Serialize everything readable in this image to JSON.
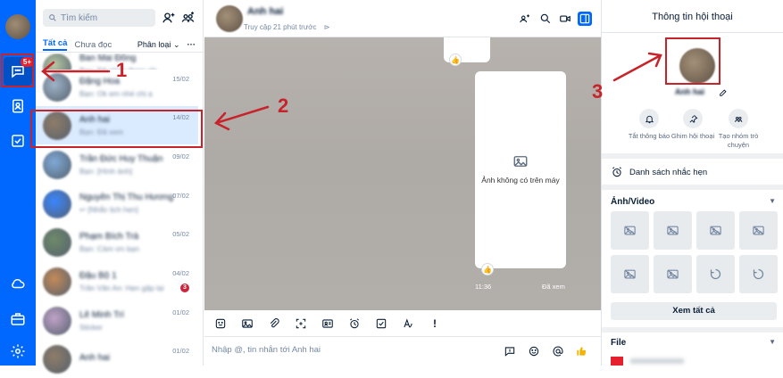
{
  "nav": {
    "badge": "5+"
  },
  "conversation_list": {
    "search_placeholder": "Tìm kiếm",
    "tabs": [
      {
        "label": "Tất cả",
        "active": true
      },
      {
        "label": "Chưa đọc",
        "active": false
      }
    ],
    "filter_label": "Phân loại",
    "more_label": "···",
    "items": [
      {
        "name": "Ban Mai Đông",
        "preview": "Bạn: Đã nhận được rồi",
        "date": "",
        "avatar_color": "#b6c9a4"
      },
      {
        "name": "Đặng Hoa",
        "preview": "Bạn: Ok em nhé chị ạ",
        "date": "15/02",
        "avatar_color": "#9fb4c8"
      },
      {
        "name": "Anh hai",
        "preview": "Bạn: Đã xem",
        "date": "14/02",
        "avatar_color": "#8f7d68",
        "selected": true
      },
      {
        "name": "Trần Đức Huy Thuận",
        "preview": "Bạn: [Hình ảnh]",
        "date": "09/02",
        "avatar_color": "#7fa9d6"
      },
      {
        "name": "Nguyễn Thị Thu Hương",
        "preview": "↩ [Nhắc lịch hẹn]",
        "date": "07/02",
        "avatar_color": "#3a86ff"
      },
      {
        "name": "Phạm Bích Trà",
        "preview": "Bạn: Cảm ơn bạn",
        "date": "05/02",
        "avatar_color": "#6e8a6a"
      },
      {
        "name": "Đậu Bộ 1",
        "preview": "Trần Văn An: Hẹn gặp lại",
        "date": "04/02",
        "avatar_color": "#c48a58",
        "unread": "3"
      },
      {
        "name": "Lê Minh Trí",
        "preview": "Sticker",
        "date": "01/02",
        "avatar_color": "#c0a3c8"
      },
      {
        "name": "Anh hai",
        "preview": "",
        "date": "01/02",
        "avatar_color": "#8f7d68"
      }
    ]
  },
  "chat": {
    "contact_name": "Anh hai",
    "status": "Truy cập 21 phút trước",
    "image_unavailable_text": "Ảnh không có trên máy",
    "time": "11:36",
    "seen": "Đã xem",
    "composer_placeholder": "Nhập @, tin nhắn tới Anh hai",
    "toolbar_exclaim": "!"
  },
  "info_panel": {
    "title": "Thông tin hội thoại",
    "contact_name": "Anh hai",
    "actions": [
      {
        "label": "Tắt thông báo",
        "icon": "bell-icon"
      },
      {
        "label": "Ghim hội thoại",
        "icon": "pin-icon"
      },
      {
        "label": "Tạo nhóm trò chuyện",
        "icon": "group-add-icon"
      }
    ],
    "reminder_label": "Danh sách nhắc hẹn",
    "media_title": "Ảnh/Video",
    "see_all_label": "Xem tất cả",
    "file_title": "File"
  },
  "annotations": {
    "callout_1": "1",
    "callout_2": "2",
    "callout_3": "3",
    "color": "#c7232a"
  }
}
